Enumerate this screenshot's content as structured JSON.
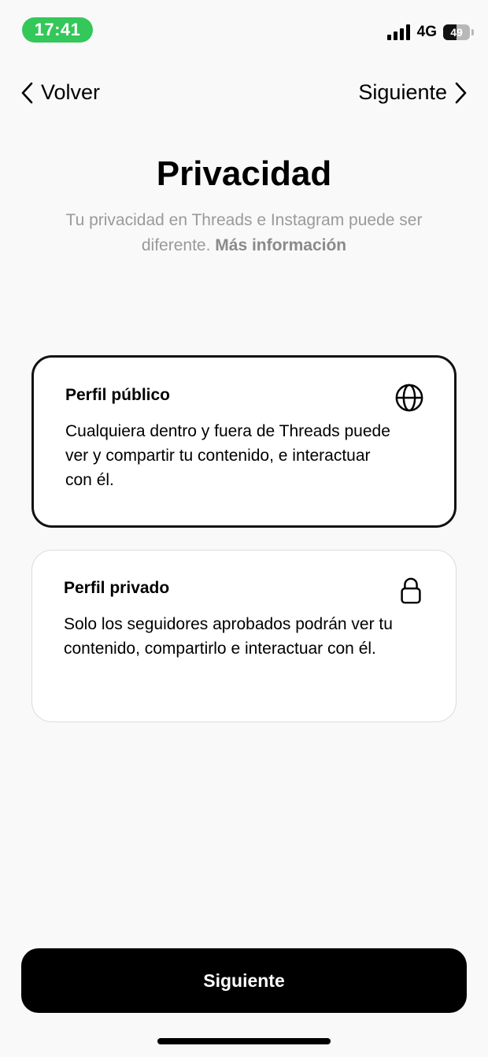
{
  "status_bar": {
    "time": "17:41",
    "network": "4G",
    "battery_level": "49",
    "battery_fraction": 0.49,
    "icons": [
      "signal-bars-icon",
      "battery-icon"
    ]
  },
  "nav": {
    "back_label": "Volver",
    "next_label": "Siguiente"
  },
  "header": {
    "title": "Privacidad",
    "subtitle": "Tu privacidad en Threads e Instagram puede ser diferente.",
    "subtitle_link": "Más información"
  },
  "options": {
    "public": {
      "title": "Perfil público",
      "description": "Cualquiera dentro y fuera de Threads puede ver y compartir tu contenido, e interactuar con él.",
      "icon": "globe-icon",
      "selected": true
    },
    "private": {
      "title": "Perfil privado",
      "description": "Solo los seguidores aprobados podrán ver tu contenido, compartirlo e interactuar con él.",
      "icon": "lock-icon",
      "selected": false
    }
  },
  "footer": {
    "button_label": "Siguiente"
  },
  "colors": {
    "background": "#f9f9f9",
    "time_pill": "#34c759",
    "primary": "#000000",
    "muted_text": "#9a9a9a"
  }
}
